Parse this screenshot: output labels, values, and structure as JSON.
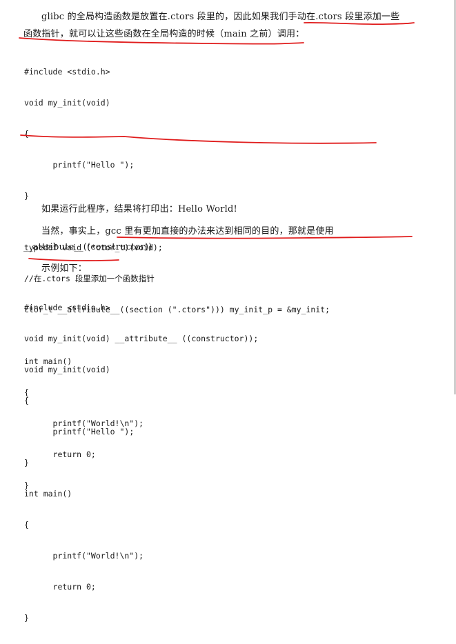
{
  "paragraphs": {
    "p1_line1": "glibc 的全局构造函数是放置在.ctors 段里的，因此如果我们手动在.ctors 段里添加一些",
    "p1_line2": "函数指针，就可以让这些函数在全局构造的时候（main 之前）调用：",
    "p2": "如果运行此程序，结果将打印出：Hello World!",
    "p3_line1": "当然，事实上，gcc 里有更加直接的办法来达到相同的目的，那就是使用",
    "p3_line2": "__attribute__((constructor))",
    "p4": "示例如下："
  },
  "code_blocks": {
    "block1": [
      "#include <stdio.h>",
      "void my_init(void)",
      "{",
      "      printf(\"Hello \");",
      "}",
      "",
      "typedef void (*ctor_t)(void);",
      "//在.ctors 段里添加一个函数指针",
      "ctor_t __attribute__((section (\".ctors\"))) my_init_p = &my_init;",
      "",
      "int main()",
      "{",
      "      printf(\"World!\\n\");",
      "      return 0;",
      "}"
    ],
    "block2": [
      "#include <stdio.h>",
      "void my_init(void) __attribute__ ((constructor));",
      "void my_init(void)",
      "{",
      "      printf(\"Hello \");",
      "}",
      "int main()",
      "{",
      "      printf(\"World!\\n\");",
      "      return 0;",
      "}"
    ]
  },
  "annotation": {
    "color": "#e01c1c",
    "kind": "hand-drawn red underlines"
  }
}
